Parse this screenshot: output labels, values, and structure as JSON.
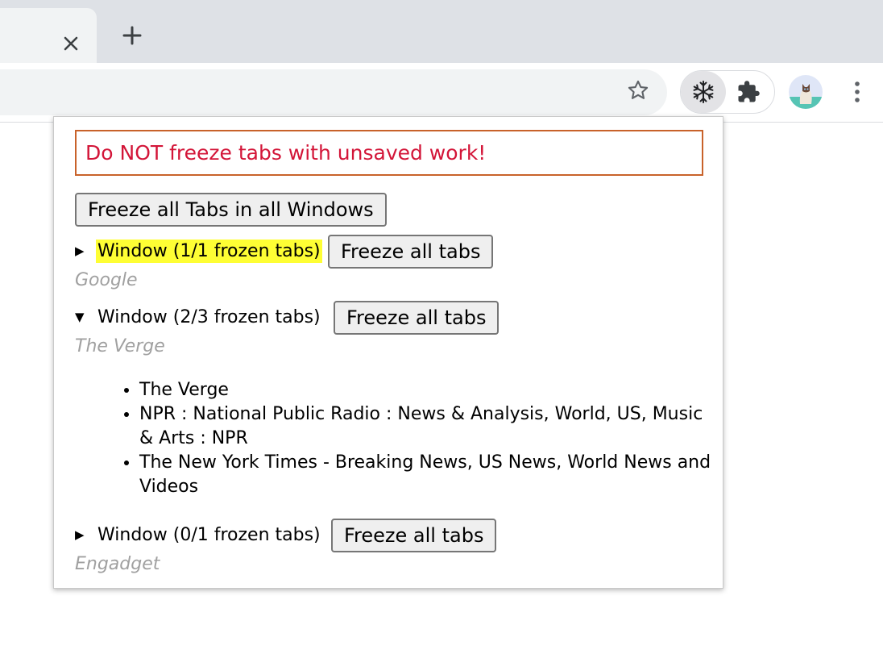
{
  "browser": {
    "close_tab_glyph": "✕",
    "new_tab_glyph": "+",
    "icons": [
      "close-icon",
      "plus-icon",
      "star-icon",
      "snowflake-icon",
      "puzzle-icon",
      "avatar",
      "more-vert-icon"
    ]
  },
  "popup": {
    "warning": "Do NOT freeze tabs with unsaved work!",
    "freeze_all_windows_label": "Freeze all Tabs in all Windows",
    "windows": [
      {
        "label": "Window (1/1 frozen tabs)",
        "button": "Freeze all tabs",
        "subtitle": "Google",
        "expanded": false,
        "highlighted": true,
        "disclosure": "▶"
      },
      {
        "label": "Window (2/3 frozen tabs)",
        "button": "Freeze all tabs",
        "subtitle": "The Verge",
        "expanded": true,
        "disclosure": "▼",
        "tabs": [
          "The Verge",
          "NPR : National Public Radio : News & Analysis, World, US, Music & Arts : NPR",
          "The New York Times - Breaking News, US News, World News and Videos"
        ]
      },
      {
        "label": "Window (0/1 frozen tabs)",
        "button": "Freeze all tabs",
        "subtitle": "Engadget",
        "expanded": false,
        "disclosure": "▶"
      }
    ]
  },
  "colors": {
    "warning_text": "#d31538",
    "warning_border": "#c8622a",
    "highlight": "#fefe34",
    "subtitle": "#a0a0a0"
  }
}
